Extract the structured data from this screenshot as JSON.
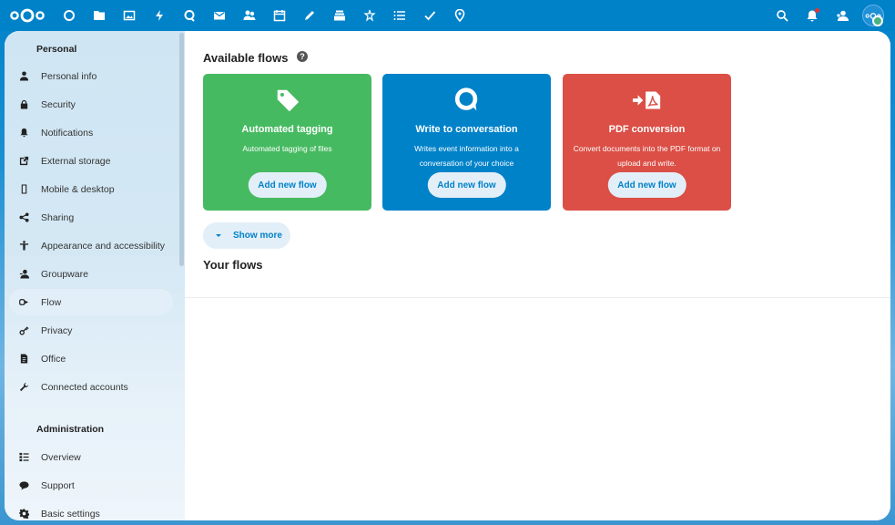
{
  "header": {
    "apps": [
      {
        "name": "dashboard",
        "icon": "circle-icon"
      },
      {
        "name": "files",
        "icon": "folder-icon"
      },
      {
        "name": "photos",
        "icon": "image-icon"
      },
      {
        "name": "activity",
        "icon": "lightning-icon"
      },
      {
        "name": "talk",
        "icon": "talk-icon"
      },
      {
        "name": "mail",
        "icon": "mail-icon"
      },
      {
        "name": "contacts",
        "icon": "contacts-icon"
      },
      {
        "name": "calendar",
        "icon": "calendar-icon"
      },
      {
        "name": "notes",
        "icon": "pencil-icon"
      },
      {
        "name": "deck",
        "icon": "deck-icon"
      },
      {
        "name": "assistant",
        "icon": "sparkle-icon"
      },
      {
        "name": "tasks",
        "icon": "list-icon"
      },
      {
        "name": "checks",
        "icon": "checkmark-icon"
      },
      {
        "name": "maps",
        "icon": "map-pin-icon"
      }
    ],
    "right": [
      "search-icon",
      "notifications-icon",
      "contacts-menu-icon"
    ]
  },
  "sidebar": {
    "personal_heading": "Personal",
    "personal_items": [
      {
        "label": "Personal info",
        "icon": "user-icon"
      },
      {
        "label": "Security",
        "icon": "lock-icon"
      },
      {
        "label": "Notifications",
        "icon": "bell-icon"
      },
      {
        "label": "External storage",
        "icon": "external-link-icon"
      },
      {
        "label": "Mobile & desktop",
        "icon": "phone-icon"
      },
      {
        "label": "Sharing",
        "icon": "share-icon"
      },
      {
        "label": "Appearance and accessibility",
        "icon": "accessibility-icon"
      },
      {
        "label": "Groupware",
        "icon": "group-icon"
      },
      {
        "label": "Flow",
        "icon": "flow-icon",
        "active": true
      },
      {
        "label": "Privacy",
        "icon": "key-icon"
      },
      {
        "label": "Office",
        "icon": "document-icon"
      },
      {
        "label": "Connected accounts",
        "icon": "wrench-icon"
      }
    ],
    "admin_heading": "Administration",
    "admin_items": [
      {
        "label": "Overview",
        "icon": "overview-list-icon"
      },
      {
        "label": "Support",
        "icon": "chat-bubble-icon"
      },
      {
        "label": "Basic settings",
        "icon": "gear-icon"
      }
    ]
  },
  "main": {
    "available_title": "Available flows",
    "help_glyph": "?",
    "cards": [
      {
        "title": "Automated tagging",
        "description": "Automated tagging of files",
        "button": "Add new flow",
        "color": "#46ba61",
        "icon": "tag-icon"
      },
      {
        "title": "Write to conversation",
        "description": "Writes event information into a conversation of your choice",
        "button": "Add new flow",
        "color": "#0082c9",
        "icon": "talk-icon"
      },
      {
        "title": "PDF conversion",
        "description": "Convert documents into the PDF format on upload and write.",
        "button": "Add new flow",
        "color": "#db4f46",
        "icon": "pdf-convert-icon"
      }
    ],
    "show_more": "Show more",
    "your_flows_title": "Your flows"
  },
  "colors": {
    "primary": "#0082c9",
    "green": "#46ba61",
    "red": "#db4f46"
  }
}
